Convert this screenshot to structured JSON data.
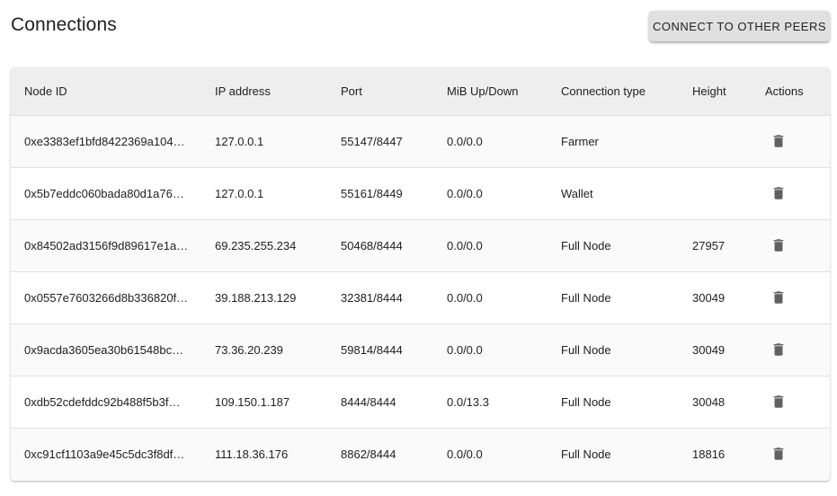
{
  "header": {
    "title": "Connections",
    "connect_button_label": "Connect to other peers"
  },
  "table": {
    "columns": [
      "Node ID",
      "IP address",
      "Port",
      "MiB Up/Down",
      "Connection type",
      "Height",
      "Actions"
    ],
    "rows": [
      {
        "node_id": "0xe3383ef1bfd8422369a104…",
        "ip": "127.0.0.1",
        "port": "55147/8447",
        "mib": "0.0/0.0",
        "type": "Farmer",
        "height": ""
      },
      {
        "node_id": "0x5b7eddc060bada80d1a76…",
        "ip": "127.0.0.1",
        "port": "55161/8449",
        "mib": "0.0/0.0",
        "type": "Wallet",
        "height": ""
      },
      {
        "node_id": "0x84502ad3156f9d89617e1a…",
        "ip": "69.235.255.234",
        "port": "50468/8444",
        "mib": "0.0/0.0",
        "type": "Full Node",
        "height": "27957"
      },
      {
        "node_id": "0x0557e7603266d8b336820f…",
        "ip": "39.188.213.129",
        "port": "32381/8444",
        "mib": "0.0/0.0",
        "type": "Full Node",
        "height": "30049"
      },
      {
        "node_id": "0x9acda3605ea30b61548bc…",
        "ip": "73.36.20.239",
        "port": "59814/8444",
        "mib": "0.0/0.0",
        "type": "Full Node",
        "height": "30049"
      },
      {
        "node_id": "0xdb52cdefddc92b488f5b3f…",
        "ip": "109.150.1.187",
        "port": "8444/8444",
        "mib": "0.0/13.3",
        "type": "Full Node",
        "height": "30048"
      },
      {
        "node_id": "0xc91cf1103a9e45c5dc3f8df…",
        "ip": "111.18.36.176",
        "port": "8862/8444",
        "mib": "0.0/0.0",
        "type": "Full Node",
        "height": "18816"
      }
    ],
    "action_icon": "trash-icon"
  },
  "colors": {
    "header_bg": "#eeeeee",
    "button_bg": "#e0e0e0",
    "icon": "#616161",
    "text": "#212121"
  }
}
